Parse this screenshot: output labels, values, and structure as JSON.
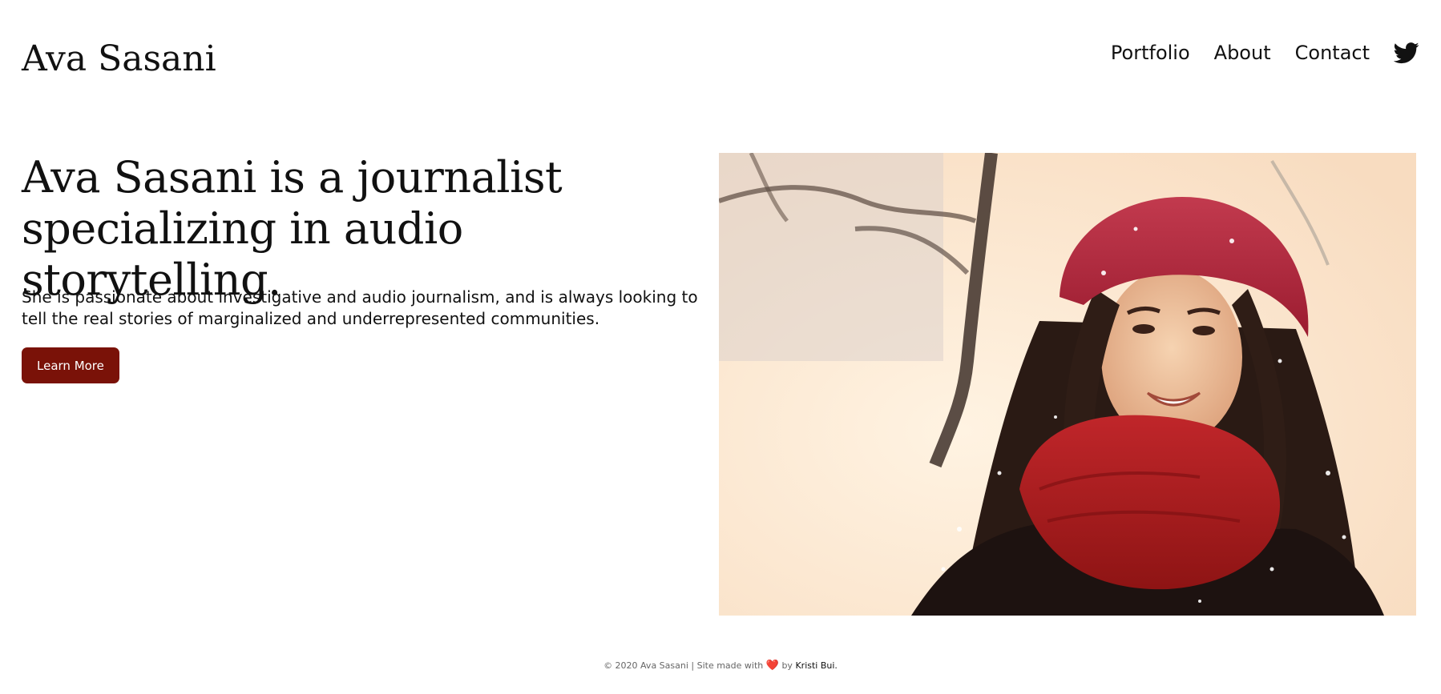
{
  "header": {
    "site_title": "Ava Sasani",
    "nav": [
      {
        "label": "Portfolio"
      },
      {
        "label": "About"
      },
      {
        "label": "Contact"
      }
    ],
    "social_icon": "twitter-icon"
  },
  "hero": {
    "headline": "Ava Sasani is a journalist specializing in audio storytelling.",
    "description": "She is passionate about investigative and audio journalism, and is always looking to tell the real stories of marginalized and underrepresented communities.",
    "cta_label": "Learn More",
    "photo_icon": "portrait-photo"
  },
  "footer": {
    "prefix": "© 2020 Ava Sasani | Site made with",
    "heart": "❤️",
    "by": "by",
    "author": "Kristi Bui."
  },
  "colors": {
    "accent": "#7a1208",
    "text": "#111111",
    "footer_text": "#666666",
    "background": "#ffffff"
  }
}
